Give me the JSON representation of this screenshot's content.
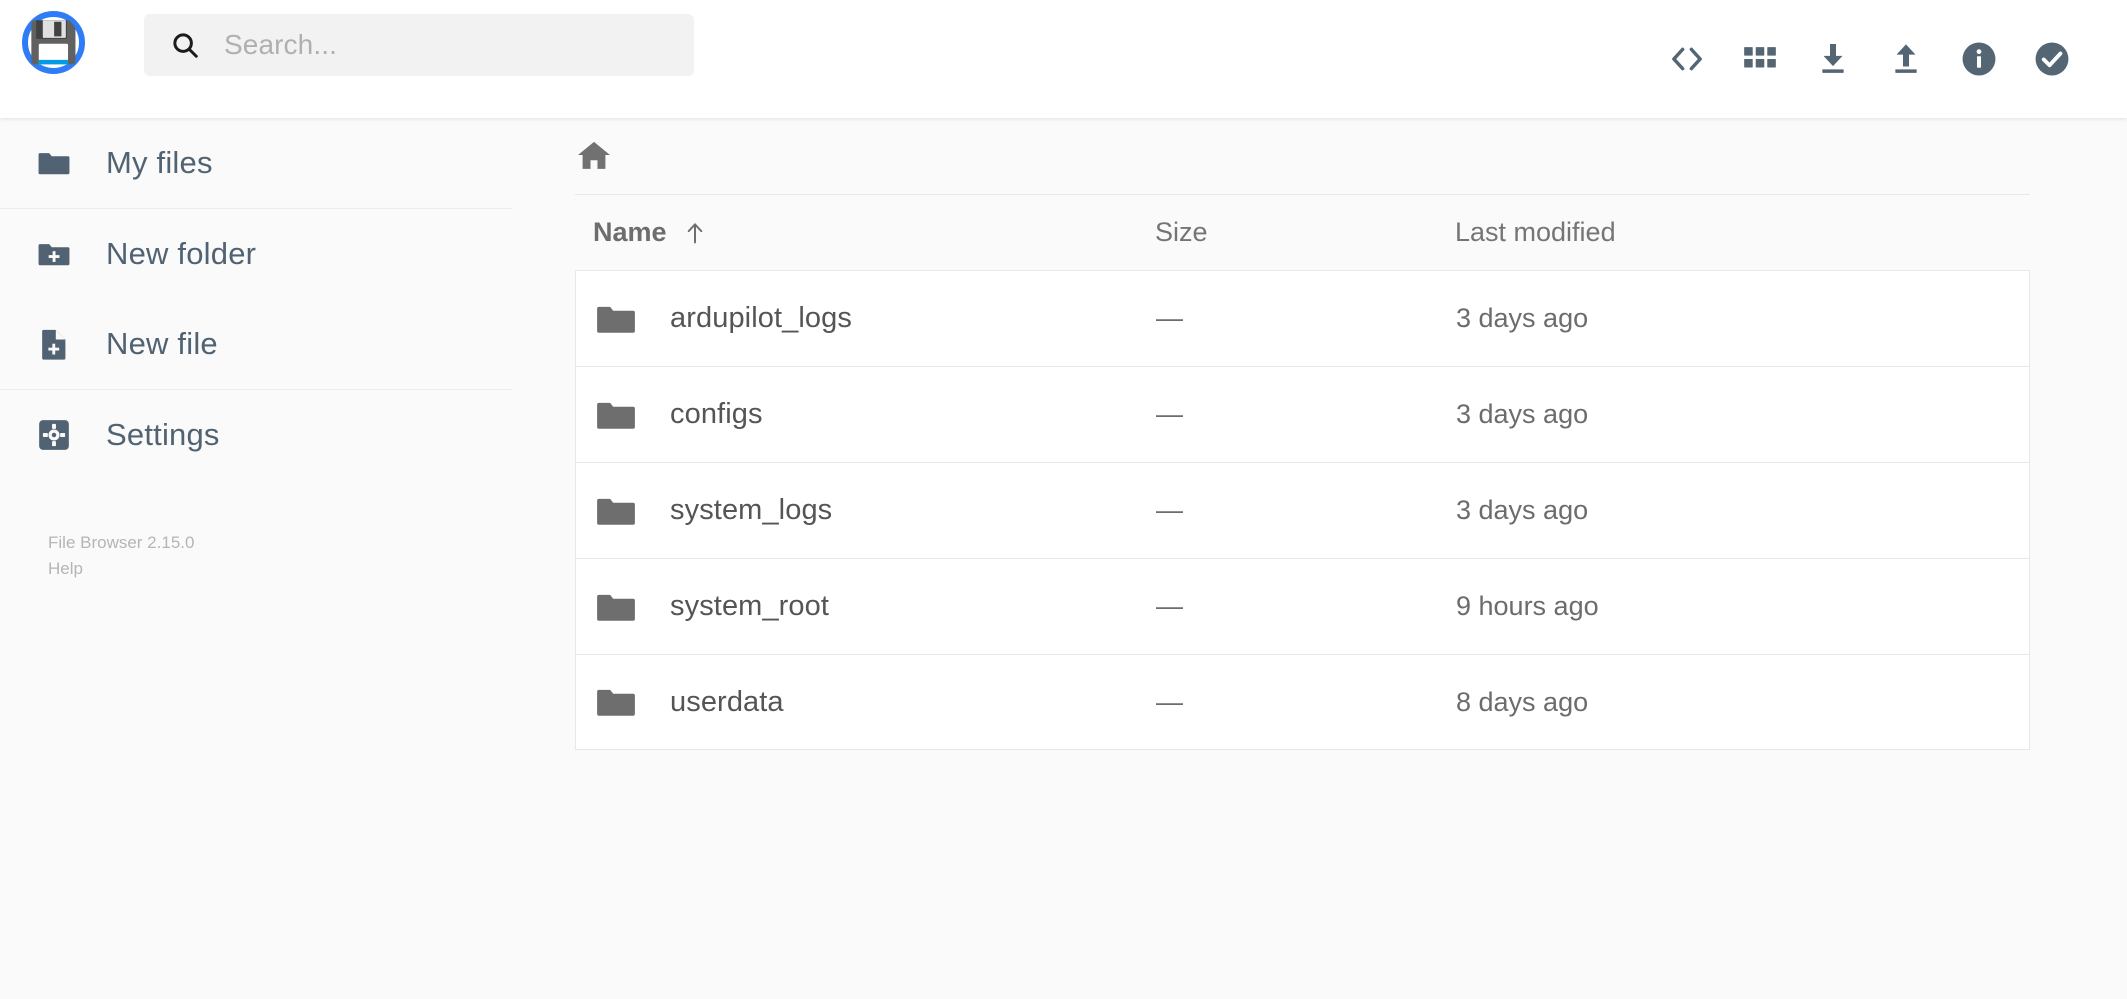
{
  "header": {
    "logo_icon": "floppy-disk-icon",
    "logo_ring_color": "#2f7df6",
    "search": {
      "placeholder": "Search...",
      "value": "",
      "icon": "search-icon"
    },
    "toolbar": [
      {
        "name": "code-brackets-icon",
        "label": "Code view"
      },
      {
        "name": "grid-view-icon",
        "label": "Switch view"
      },
      {
        "name": "download-icon",
        "label": "Download"
      },
      {
        "name": "upload-icon",
        "label": "Upload"
      },
      {
        "name": "info-circle-icon",
        "label": "Info"
      },
      {
        "name": "check-circle-icon",
        "label": "Select multiple"
      }
    ],
    "toolbar_color": "#546673"
  },
  "sidebar": {
    "groups": [
      {
        "items": [
          {
            "label": "My files",
            "icon": "folder-icon",
            "name": "sidebar-item-my-files"
          }
        ]
      },
      {
        "items": [
          {
            "label": "New folder",
            "icon": "folder-plus-icon",
            "name": "sidebar-item-new-folder"
          },
          {
            "label": "New file",
            "icon": "file-plus-icon",
            "name": "sidebar-item-new-file"
          }
        ]
      },
      {
        "items": [
          {
            "label": "Settings",
            "icon": "gear-icon",
            "name": "sidebar-item-settings"
          }
        ]
      }
    ],
    "credits": {
      "version": "File Browser 2.15.0",
      "help": "Help"
    },
    "text_color": "#516372"
  },
  "main": {
    "breadcrumb": {
      "home_icon": "home-icon",
      "path": "/"
    },
    "table": {
      "columns": [
        {
          "key": "name",
          "label": "Name",
          "sorted": true,
          "sort_dir": "asc"
        },
        {
          "key": "size",
          "label": "Size",
          "sorted": false,
          "sort_dir": ""
        },
        {
          "key": "modif",
          "label": "Last modified",
          "sorted": false,
          "sort_dir": ""
        }
      ],
      "rows": [
        {
          "icon": "folder-icon",
          "name": "ardupilot_logs",
          "size": "—",
          "modified": "3 days ago"
        },
        {
          "icon": "folder-icon",
          "name": "configs",
          "size": "—",
          "modified": "3 days ago"
        },
        {
          "icon": "folder-icon",
          "name": "system_logs",
          "size": "—",
          "modified": "3 days ago"
        },
        {
          "icon": "folder-icon",
          "name": "system_root",
          "size": "—",
          "modified": "9 hours ago"
        },
        {
          "icon": "folder-icon",
          "name": "userdata",
          "size": "—",
          "modified": "8 days ago"
        }
      ]
    }
  },
  "colors": {
    "page_background": "#fafafa",
    "header_background": "#ffffff",
    "row_background": "#ffffff",
    "row_border": "#e8e8e8",
    "accent_blue": "#2f7df6",
    "folder_gray": "#6e6e6e",
    "muted_text": "#b5b5b5"
  }
}
